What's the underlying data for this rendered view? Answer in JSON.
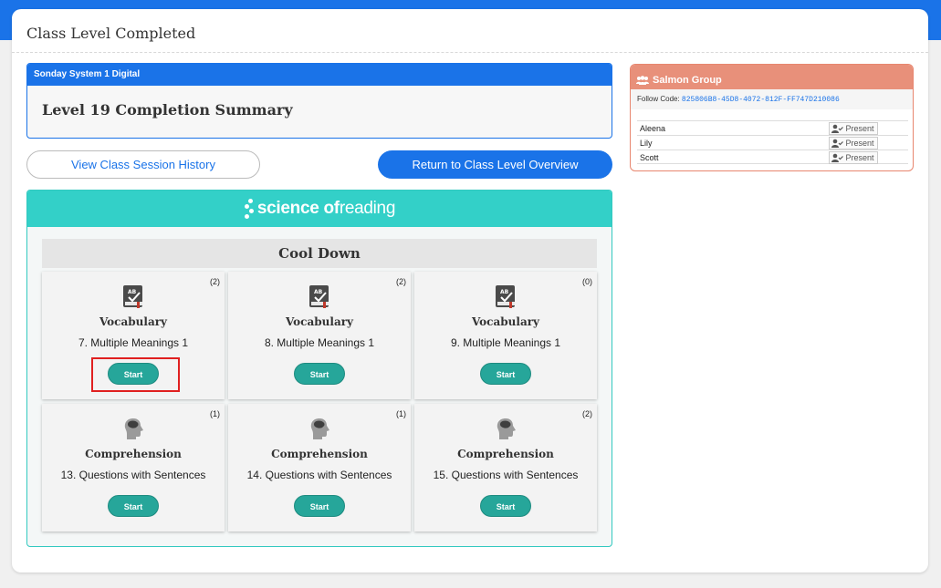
{
  "page": {
    "title": "Class Level Completed"
  },
  "summary": {
    "header": "Sonday System 1 Digital",
    "title": "Level 19 Completion Summary"
  },
  "actions": {
    "history_label": "View Class Session History",
    "return_label": "Return to Class Level Overview"
  },
  "program": {
    "brand_bold": "science of",
    "brand_light": " reading",
    "section": "Cool Down"
  },
  "tiles": [
    {
      "count": "(2)",
      "title": "Vocabulary",
      "subtitle": "7. Multiple Meanings 1",
      "button": "Start",
      "icon": "vocabulary-book-icon"
    },
    {
      "count": "(2)",
      "title": "Vocabulary",
      "subtitle": "8. Multiple Meanings 1",
      "button": "Start",
      "icon": "vocabulary-book-icon"
    },
    {
      "count": "(0)",
      "title": "Vocabulary",
      "subtitle": "9. Multiple Meanings 1",
      "button": "Start",
      "icon": "vocabulary-book-icon"
    },
    {
      "count": "(1)",
      "title": "Comprehension",
      "subtitle": "13. Questions with Sentences",
      "button": "Start",
      "icon": "brain-head-icon"
    },
    {
      "count": "(1)",
      "title": "Comprehension",
      "subtitle": "14. Questions with Sentences",
      "button": "Start",
      "icon": "brain-head-icon"
    },
    {
      "count": "(2)",
      "title": "Comprehension",
      "subtitle": "15. Questions with Sentences",
      "button": "Start",
      "icon": "brain-head-icon"
    }
  ],
  "group": {
    "name": "Salmon Group",
    "follow_label": "Follow Code:",
    "follow_code": "825806B8-45D8-4072-812F-FF747D210086",
    "students": [
      {
        "name": "Aleena",
        "status": "Present"
      },
      {
        "name": "Lily",
        "status": "Present"
      },
      {
        "name": "Scott",
        "status": "Present"
      }
    ]
  },
  "colors": {
    "primary": "#1a73e8",
    "teal": "#33d0c8",
    "start": "#26a69a",
    "group": "#e8907a",
    "highlight": "#e02020"
  }
}
